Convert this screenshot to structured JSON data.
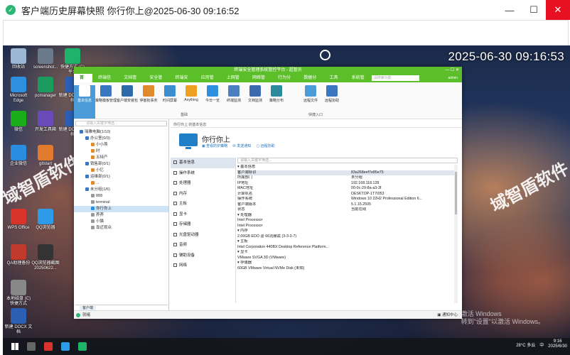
{
  "viewer": {
    "title": "客户端历史屏幕快照 你行你上@2025-06-30 09:16:52",
    "minimize": "—",
    "maximize": "☐",
    "close": "✕"
  },
  "desktop": {
    "clock": "2025-06-30 09:16:53",
    "watermark": "域智盾软件",
    "icons": [
      {
        "label": "回收站",
        "color": "#9bb7d4"
      },
      {
        "label": "screenshot...",
        "color": "#6a7a8a"
      },
      {
        "label": "快捷方式 (C) 平台",
        "color": "#1eb36b"
      },
      {
        "label": "Microsoft Edge",
        "color": "#2d8fe0"
      },
      {
        "label": "pcmanager",
        "color": "#1c9b5e"
      },
      {
        "label": "新建 DOCX 文档",
        "color": "#2b5fb4"
      },
      {
        "label": "微信",
        "color": "#1aad19"
      },
      {
        "label": "开发工具箱",
        "color": "#6a4ab8"
      },
      {
        "label": "新建 DOCX 文档",
        "color": "#2b5fb4"
      },
      {
        "label": "企业微信",
        "color": "#2a8ee0"
      },
      {
        "label": "gitstart",
        "color": "#e07a2d"
      },
      {
        "label": "WPS Office",
        "color": "#d9342b"
      },
      {
        "label": "QQ浏览器",
        "color": "#2e9be8"
      },
      {
        "label": "QA助理备份",
        "color": "#c0392b"
      },
      {
        "label": "QQ浏览器截图20250622...",
        "color": "#333333"
      },
      {
        "label": "本地磁盘 (C) 快捷方式",
        "color": "#888888"
      },
      {
        "label": "新建 DOCX 文档",
        "color": "#2b5fb4"
      }
    ],
    "activate": {
      "line1": "激活 Windows",
      "line2": "转到\"设置\"以激活 Windows。"
    },
    "taskbar": {
      "weather": "28°C 多云",
      "ime": "中",
      "time": "9:16",
      "date": "2025/6/30"
    }
  },
  "app": {
    "title": "终端安全管理系统管控平台 - 超管员",
    "window_controls": "— ☐ ✕",
    "menu": [
      "首页",
      "终端信息",
      "文档管理",
      "安全管理",
      "终端安全",
      "应用管理",
      "上网管理",
      "网络管控",
      "行为分析",
      "数据分析",
      "工具箱",
      "系统管理"
    ],
    "menu_search": "请搜索功能",
    "user": "admin",
    "ribbon": [
      {
        "label": "基本信息",
        "color": "#4a9bd7"
      },
      {
        "label": "策略模板管理",
        "color": "#3a77c0"
      },
      {
        "label": "客户端安装包",
        "color": "#2c6aa8"
      },
      {
        "label": "停客批事务",
        "color": "#e08a2d"
      },
      {
        "label": "时间屏幕",
        "color": "#3b8fd0"
      },
      {
        "label": "Anything",
        "color": "#f0a020"
      },
      {
        "label": "今日一览",
        "color": "#2d8fe0"
      },
      {
        "label": "终端监测",
        "color": "#4a7fc0"
      },
      {
        "label": "文档监测",
        "color": "#3a6ab0"
      },
      {
        "label": "策略分布",
        "color": "#2c8a9a"
      },
      {
        "label": "远程文件",
        "color": "#4a9bd7"
      },
      {
        "label": "远程协助",
        "color": "#3a77c0"
      }
    ],
    "ribbon_groups": [
      "基础",
      "快捷入口"
    ],
    "tree_search": "请输入关键字筛选...",
    "tree": [
      {
        "label": "瑞雅电脑(1/10)",
        "indent": 1,
        "color": "#3a77c0"
      },
      {
        "label": "办公室(0/3)",
        "indent": 2,
        "color": "#3a77c0"
      },
      {
        "label": "小小燕",
        "indent": 3,
        "color": "#e08a2d"
      },
      {
        "label": "时",
        "indent": 3,
        "color": "#e08a2d"
      },
      {
        "label": "五特产",
        "indent": 3,
        "color": "#e08a2d"
      },
      {
        "label": "销售部(0/1)",
        "indent": 2,
        "color": "#3a77c0"
      },
      {
        "label": "小忆",
        "indent": 3,
        "color": "#e08a2d"
      },
      {
        "label": "运维部(0/1)",
        "indent": 2,
        "color": "#3a77c0"
      },
      {
        "label": "...",
        "indent": 3,
        "color": "#e08a2d"
      },
      {
        "label": "未分组(1/6)",
        "indent": 2,
        "color": "#3a77c0"
      },
      {
        "label": "888",
        "indent": 3,
        "color": "#999999"
      },
      {
        "label": "terminal",
        "indent": 3,
        "color": "#999999"
      },
      {
        "label": "你行你上",
        "indent": 3,
        "color": "#2d8fe0",
        "selected": true
      },
      {
        "label": "养养",
        "indent": 3,
        "color": "#999999"
      },
      {
        "label": "小猫",
        "indent": 3,
        "color": "#999999"
      },
      {
        "label": "靠近观众",
        "indent": 3,
        "color": "#999999"
      }
    ],
    "tree_tab": "客户端",
    "breadcrumb": "你行你上 的基本信息",
    "host_name": "你行你上",
    "host_actions": [
      "▣ 查看防护策略",
      "✉ 发送通知",
      "▢ 远程协助"
    ],
    "nav": [
      {
        "label": "基本信息",
        "active": true
      },
      {
        "label": "操作系统"
      },
      {
        "label": "处理器"
      },
      {
        "label": "内存"
      },
      {
        "label": "主板"
      },
      {
        "label": "显卡"
      },
      {
        "label": "存储器"
      },
      {
        "label": "光盘驱动器"
      },
      {
        "label": "音频"
      },
      {
        "label": "辅助设备"
      },
      {
        "label": "网络"
      }
    ],
    "props_search": "请输入关键字筛选...",
    "props": [
      {
        "k": "▾ 基本信息",
        "v": "",
        "cat": true
      },
      {
        "k": "     客户端标识",
        "v": "83a268eef7e85e75",
        "hl": true
      },
      {
        "k": "     所属部门",
        "v": "未分组"
      },
      {
        "k": "     IP地址",
        "v": "192.168.118.128"
      },
      {
        "k": "     MAC地址",
        "v": "00-0c-29-8a-a3-3f"
      },
      {
        "k": "     计算机名",
        "v": "DESKTOP-1T7I053"
      },
      {
        "k": "     操作系统",
        "v": "Windows 10 22H2 Professional Edition 6..."
      },
      {
        "k": "     客户端版本",
        "v": "5.1.15.2505"
      },
      {
        "k": "     状态",
        "v": "当前在线"
      },
      {
        "k": "▾ 处理器",
        "v": "",
        "cat": true
      },
      {
        "k": "     Intel Processor",
        "v": ""
      },
      {
        "k": "     Intel Processor",
        "v": ""
      },
      {
        "k": "▾ 内存",
        "v": "",
        "cat": true
      },
      {
        "k": "     2.00GB EDO @ 66兆赫兹 (3-3-3-7)",
        "v": ""
      },
      {
        "k": "▾ 主板",
        "v": "",
        "cat": true
      },
      {
        "k": "     Intel Corporation 440BX Desktop Reference Platform...",
        "v": ""
      },
      {
        "k": "▾ 显卡",
        "v": "",
        "cat": true
      },
      {
        "k": "     VMware SVGA 3D (VMware)",
        "v": ""
      },
      {
        "k": "▾ 存储器",
        "v": "",
        "cat": true
      },
      {
        "k": "     60GB VMware Virtual NVMe Disk (未知)",
        "v": ""
      }
    ],
    "status_left": "就绪",
    "status_right": "▣ 通知中心"
  }
}
